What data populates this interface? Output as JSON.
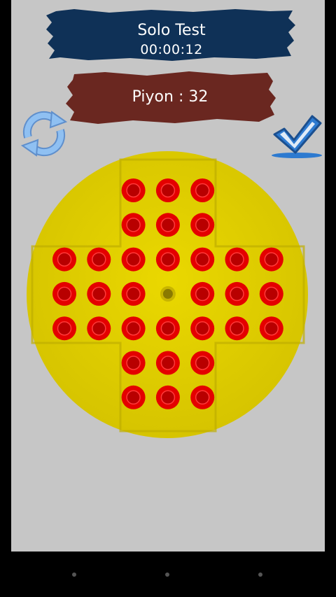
{
  "header": {
    "title": "Solo Test",
    "timer": "00:00:12",
    "pawn_count_text": "Piyon : 32"
  },
  "colors": {
    "title_banner": "#0f3157",
    "pawn_banner": "#6a2720",
    "board": "#e0cf00",
    "peg": "#e40000",
    "peg_center": "#b80000",
    "icon_blue": "#7db2ea",
    "check_blue": "#2d7ad0",
    "background": "#c6c6c6"
  },
  "icons": {
    "restart": "refresh-icon",
    "confirm": "checkmark-icon"
  },
  "board": {
    "layout": "english-cross-7x7",
    "rows": [
      [
        null,
        null,
        1,
        1,
        1,
        null,
        null
      ],
      [
        null,
        null,
        1,
        1,
        1,
        null,
        null
      ],
      [
        1,
        1,
        1,
        1,
        1,
        1,
        1
      ],
      [
        1,
        1,
        1,
        0,
        1,
        1,
        1
      ],
      [
        1,
        1,
        1,
        1,
        1,
        1,
        1
      ],
      [
        null,
        null,
        1,
        1,
        1,
        null,
        null
      ],
      [
        null,
        null,
        1,
        1,
        1,
        null,
        null
      ]
    ]
  },
  "nav": {
    "buttons": [
      "back",
      "home",
      "recent"
    ]
  }
}
